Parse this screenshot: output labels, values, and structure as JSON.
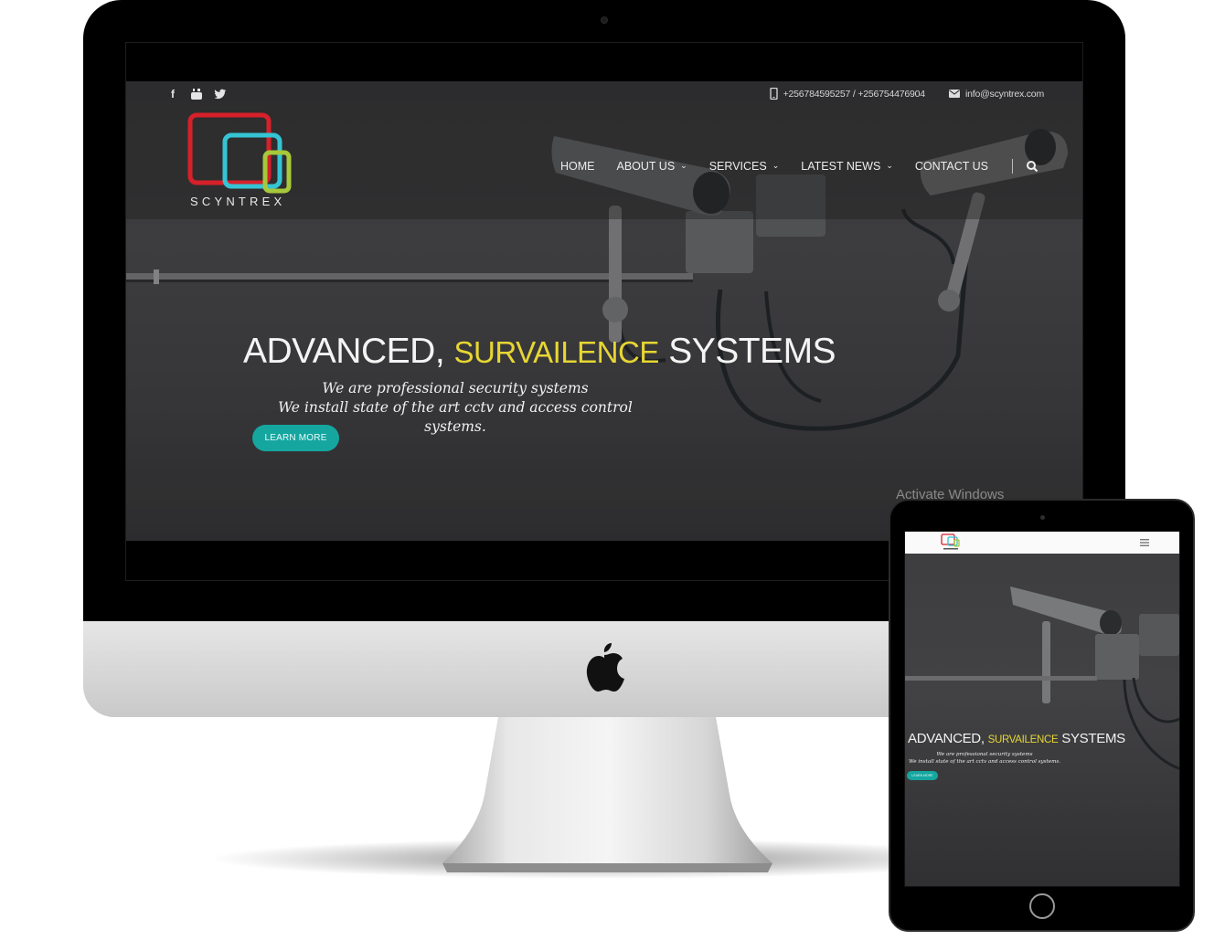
{
  "site": {
    "social": [
      {
        "name": "facebook-icon",
        "glyph": "f"
      },
      {
        "name": "youtube-icon",
        "glyph": "▶"
      },
      {
        "name": "twitter-icon",
        "glyph": "🐦"
      }
    ],
    "phone": "+256784595257 / +256754476904",
    "email": "info@scyntrex.com",
    "logo_text": "SCYNTREX",
    "nav": {
      "home": "HOME",
      "about": "ABOUT US",
      "services": "SERVICES",
      "news": "LATEST NEWS",
      "contact": "CONTACT US",
      "chevron": "⌄"
    },
    "hero": {
      "title_start": "ADVANCED, ",
      "title_accent": "SURVAILENCE",
      "title_end": " SYSTEMS",
      "line1": "We are professional security systems",
      "line2": "We install state of the art cctv and access control systems.",
      "button": "LEARN MORE"
    },
    "watermark": "Activate Windows"
  },
  "colors": {
    "accent_yellow": "#e7d633",
    "button_teal": "#16a6a0",
    "logo_red": "#d6202a",
    "logo_cyan": "#35c4d4",
    "logo_green": "#a6c83a"
  }
}
